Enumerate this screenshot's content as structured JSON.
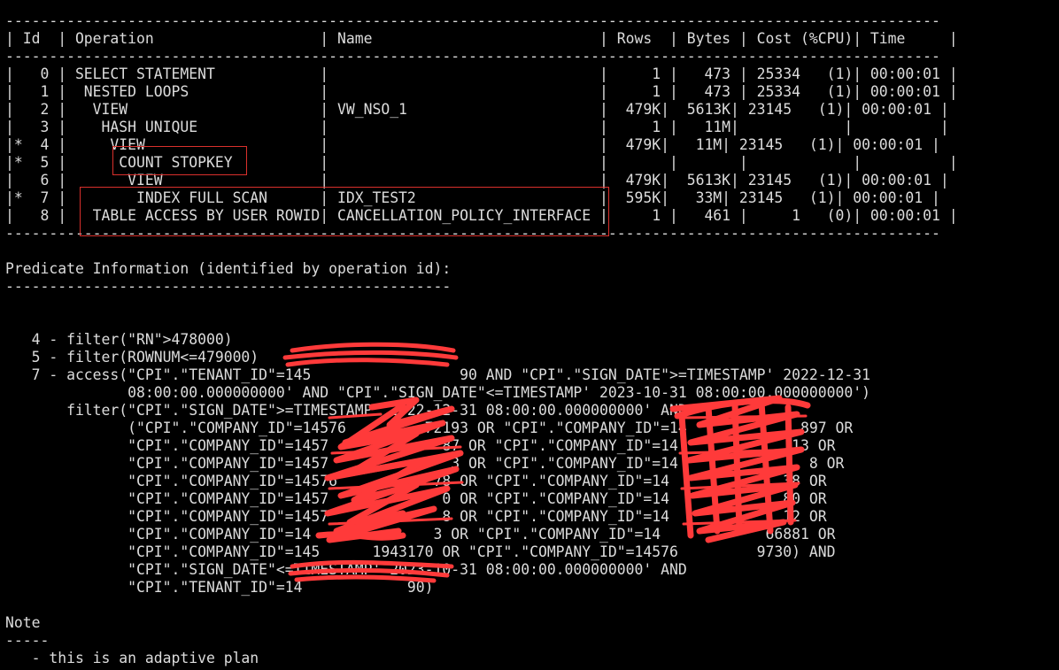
{
  "terminal": {
    "lines": [
      "-----------------------------------------------------------------------------------------------------------",
      "| Id  | Operation                   | Name                          | Rows  | Bytes | Cost (%CPU)| Time     |",
      "-----------------------------------------------------------------------------------------------------------",
      "|   0 | SELECT STATEMENT            |                               |     1 |   473 | 25334   (1)| 00:00:01 |",
      "|   1 |  NESTED LOOPS               |                               |     1 |   473 | 25334   (1)| 00:00:01 |",
      "|   2 |   VIEW                      | VW_NSO_1                      |  479K|  5613K| 23145   (1)| 00:00:01 |",
      "|   3 |    HASH UNIQUE              |                               |     1 |   11M|            |          |",
      "|*  4 |     VIEW                    |                               |  479K|   11M| 23145   (1)| 00:00:01 |",
      "|*  5 |      COUNT STOPKEY          |                               |       |       |            |          |",
      "|   6 |       VIEW                  |                               |  479K|  5613K| 23145   (1)| 00:00:01 |",
      "|*  7 |        INDEX FULL SCAN      | IDX_TEST2                     |  595K|   33M| 23145   (1)| 00:00:01 |",
      "|   8 |   TABLE ACCESS BY USER ROWID| CANCELLATION_POLICY_INTERFACE |     1 |   461 |     1   (0)| 00:00:01 |",
      "-----------------------------------------------------------------------------------------------------------",
      "",
      "Predicate Information (identified by operation id):",
      "---------------------------------------------------",
      "",
      "",
      "   4 - filter(\"RN\">478000)",
      "   5 - filter(ROWNUM<=479000)",
      "   7 - access(\"CPI\".\"TENANT_ID\"=145                 90 AND \"CPI\".\"SIGN_DATE\">=TIMESTAMP' 2022-12-31",
      "              08:00:00.000000000' AND \"CPI\".\"SIGN_DATE\"<=TIMESTAMP' 2023-10-31 08:00:00.000000000')",
      "       filter(\"CPI\".\"SIGN_DATE\">=TIMESTAMP' 2022-12-31 08:00:00.000000000' AND",
      "              (\"CPI\".\"COMPANY_ID\"=14576         72193 OR \"CPI\".\"COMPANY_ID\"=14             897 OR",
      "              \"CPI\".\"COMPANY_ID\"=1457             87 OR \"CPI\".\"COMPANY_ID\"=14             13 OR",
      "              \"CPI\".\"COMPANY_ID\"=1457              3 OR \"CPI\".\"COMPANY_ID\"=14               8 OR",
      "              \"CPI\".\"COMPANY_ID\"=14576           78 OR \"CPI\".\"COMPANY_ID\"=14             38 OR",
      "              \"CPI\".\"COMPANY_ID\"=1457             0 OR \"CPI\".\"COMPANY_ID\"=14             80 OR",
      "              \"CPI\".\"COMPANY_ID\"=1457             8 OR \"CPI\".\"COMPANY_ID\"=14             12 OR",
      "              \"CPI\".\"COMPANY_ID\"=14              3 OR \"CPI\".\"COMPANY_ID\"=14            66881 OR",
      "              \"CPI\".\"COMPANY_ID\"=145      1943170 OR \"CPI\".\"COMPANY_ID\"=14576         9730) AND",
      "              \"CPI\".\"SIGN_DATE\"<=TIMESTAMP' 2023-10-31 08:00:00.000000000' AND",
      "              \"CPI\".\"TENANT_ID\"=14            90)",
      "",
      "Note",
      "-----",
      "   - this is an adaptive plan"
    ]
  },
  "colors": {
    "background": "#000000",
    "text": "#dcdcdc",
    "highlight_box": "#d9302c",
    "redaction": "#ff3a3a"
  }
}
